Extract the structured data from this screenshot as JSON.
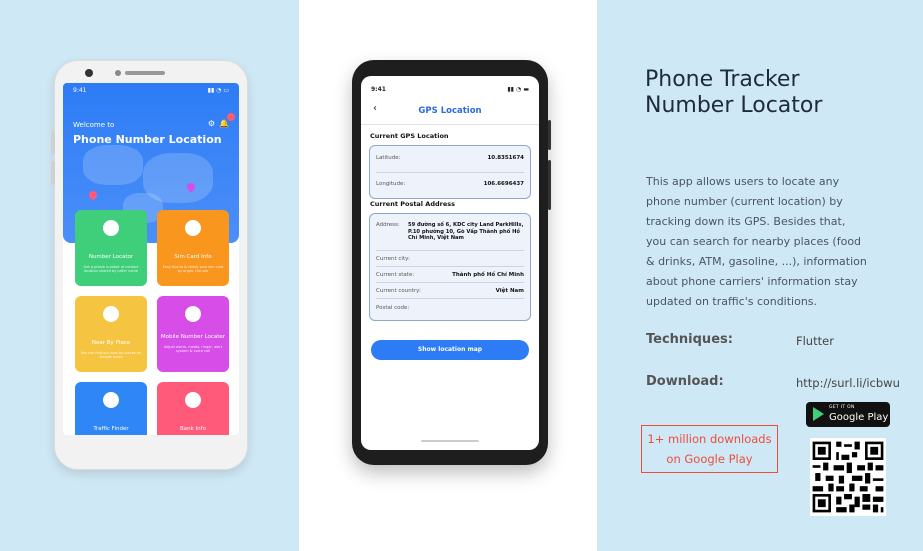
{
  "phone1": {
    "time": "9:41",
    "welcome": "Welcome to",
    "title": "Phone Number Location",
    "tiles": [
      {
        "title": "Number Locator",
        "desc": "Get a phone number of contact location shared by caller name",
        "color": "#3fcf7a"
      },
      {
        "title": "Sim Card Info",
        "desc": "Easy tips to & check your sim card by origin, the sim",
        "color": "#f8961e"
      },
      {
        "title": "Near By Place",
        "desc": "You can find out near by places on Google maps",
        "color": "#f5c542"
      },
      {
        "title": "Mobile Number Locater",
        "desc": "Adjust alarm, media, ringer, alert system & voice call",
        "color": "#d64de8"
      },
      {
        "title": "Traffic Finder",
        "desc": "",
        "color": "#2f86f6"
      },
      {
        "title": "Bank Info",
        "desc": "",
        "color": "#ff5a7a"
      }
    ]
  },
  "phone2": {
    "time": "9:41",
    "title": "GPS Location",
    "current_gps": "Current GPS  Location",
    "latitude_label": "Latitude:",
    "latitude_value": "10.8351674",
    "longitude_label": "Longitude:",
    "longitude_value": "106.6696437",
    "postal_title": "Current Postal Address",
    "address_label": "Address:",
    "address_value": "59 đường số 6, KDC city Land ParkHills, P.10 phường 10, Gò Vấp Thành phố Hồ Chí Minh, Việt Nam",
    "city_label": "Current city:",
    "city_value": "",
    "state_label": "Current state:",
    "state_value": "Thành phố Hồ Chí Minh",
    "country_label": "Current country:",
    "country_value": "Việt Nam",
    "postal_label": "Postal code:",
    "postal_value": "",
    "button": "Show location map"
  },
  "info": {
    "title_line1": "Phone Tracker",
    "title_line2": "Number Locator",
    "description": "This app allows users to locate any phone number (current location) by tracking down its GPS. Besides that, you can search for nearby places (food & drinks, ATM, gasoline, ...), information about phone carriers' information stay updated on traffic's conditions.",
    "techniques_label": "Techniques:",
    "techniques_value": "Flutter",
    "download_label": "Download:",
    "download_value": "http://surl.li/icbwu",
    "badge_line1": "1+ million downloads",
    "badge_line2": "on Google Play",
    "gplay_small": "GET IT ON",
    "gplay_big": "Google Play"
  }
}
